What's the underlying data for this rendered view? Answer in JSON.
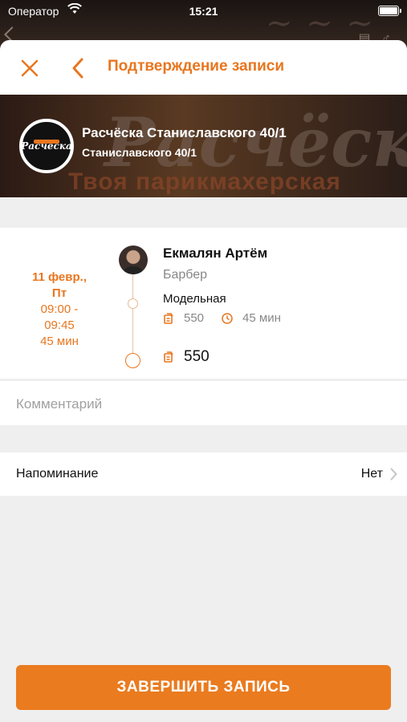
{
  "status_bar": {
    "carrier": "Оператор",
    "time": "15:21"
  },
  "header": {
    "title": "Подтверждение записи"
  },
  "salon": {
    "name": "Расчёска Станиславского 40/1",
    "address": "Станиславского 40/1",
    "logo_text": "Расчёска",
    "banner_word": "Расчёска",
    "banner_tagline": "Твоя парикмахерская"
  },
  "booking": {
    "date_line1": "11 февр.,",
    "date_line2": "Пт",
    "time_start": "09:00 -",
    "time_end": "09:45",
    "duration": "45 мин",
    "master_name": "Екмалян Артём",
    "master_role": "Барбер",
    "service_name": "Модельная",
    "service_price": "550",
    "service_duration": "45 мин",
    "total": "550"
  },
  "comment": {
    "placeholder": "Комментарий"
  },
  "reminder": {
    "label": "Напоминание",
    "value": "Нет"
  },
  "submit": {
    "label": "ЗАВЕРШИТЬ ЗАПИСЬ"
  },
  "colors": {
    "accent": "#e8761f",
    "background": "#efefef"
  }
}
